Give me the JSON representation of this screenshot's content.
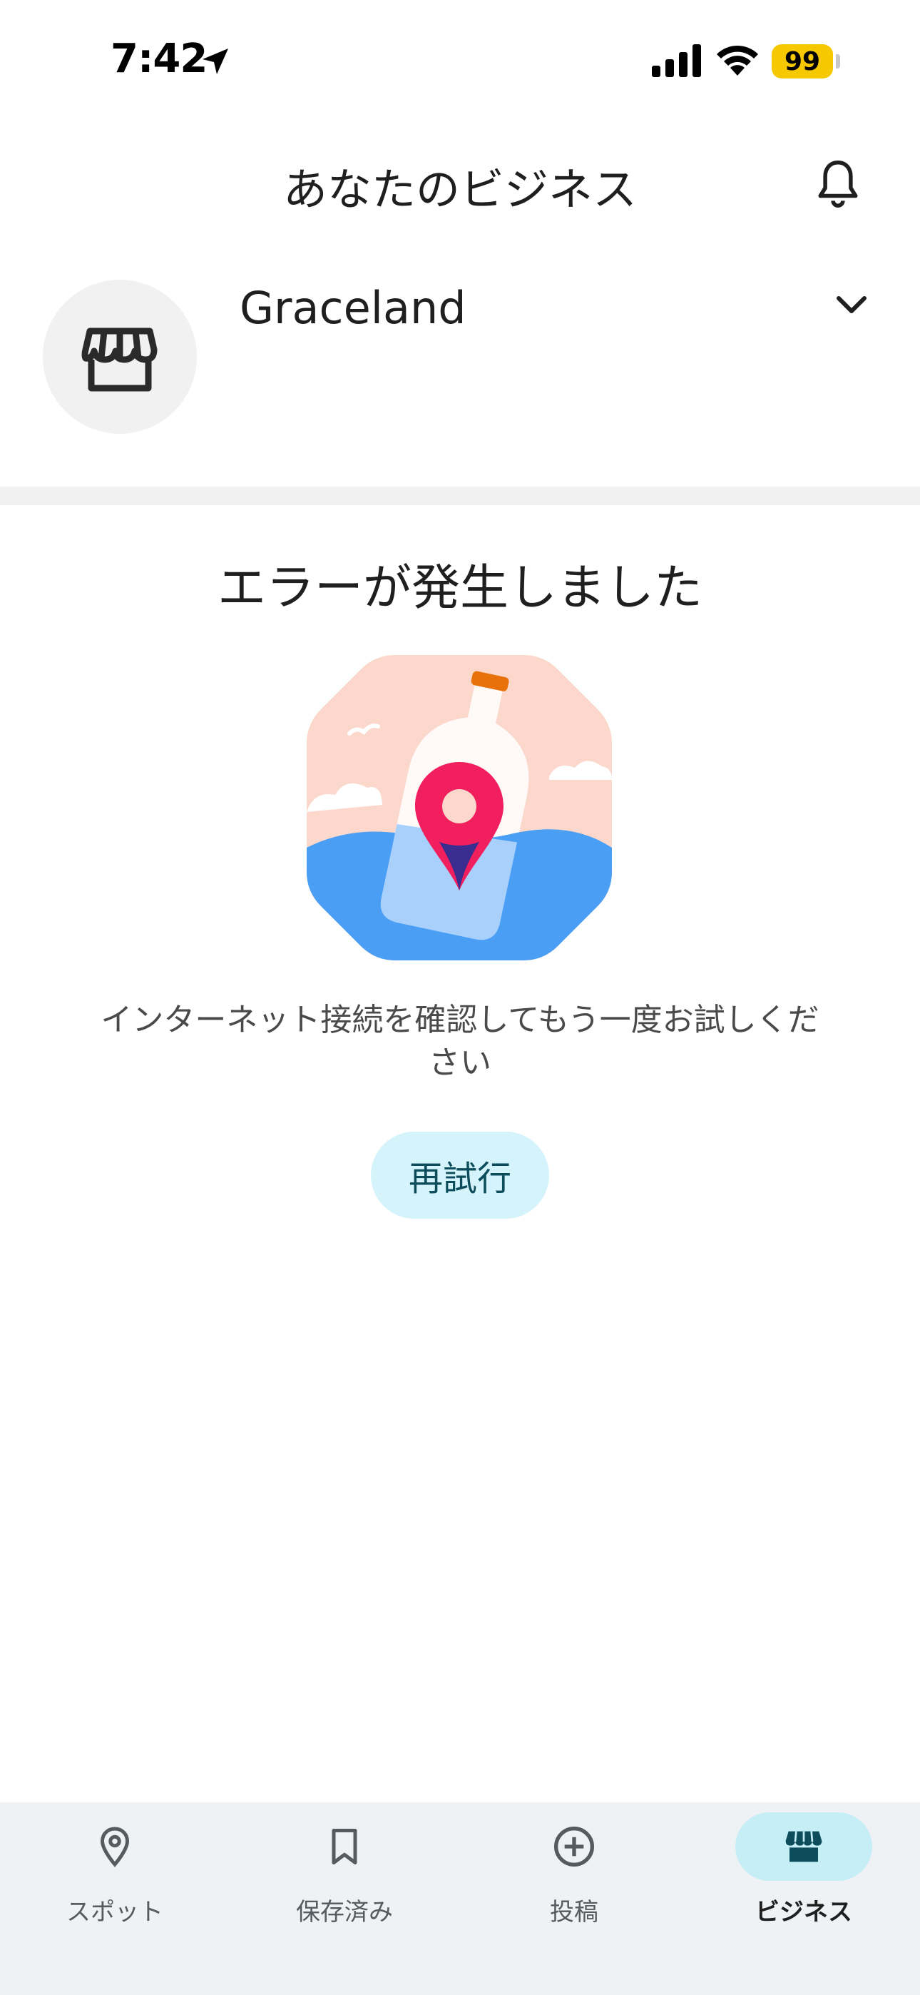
{
  "status_bar": {
    "time": "7:42",
    "battery": "99"
  },
  "header": {
    "title": "あなたのビジネス"
  },
  "business": {
    "name": "Graceland"
  },
  "error": {
    "title": "エラーが発生しました",
    "message": "インターネット接続を確認してもう一度お試しください",
    "retry_label": "再試行"
  },
  "bottom_nav": {
    "items": [
      {
        "label": "スポット",
        "icon": "pin-icon",
        "active": false
      },
      {
        "label": "保存済み",
        "icon": "bookmark-icon",
        "active": false
      },
      {
        "label": "投稿",
        "icon": "add-circle-icon",
        "active": false
      },
      {
        "label": "ビジネス",
        "icon": "storefront-icon",
        "active": true
      }
    ]
  },
  "colors": {
    "accent": "#c6eef6",
    "retry_bg": "#d4f3fb",
    "pin": "#f21f5e",
    "water": "#4a9ff5",
    "battery": "#f6c800"
  }
}
